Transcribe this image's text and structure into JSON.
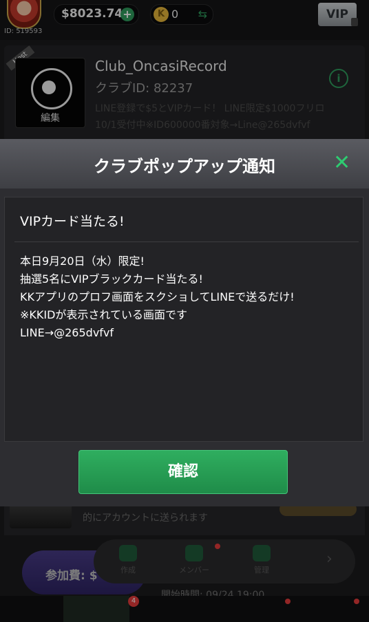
{
  "header": {
    "player_id": "ID: 519593",
    "balance": "$8023.74",
    "coins": "0",
    "vip_label": "VIP"
  },
  "club": {
    "host_tag": "Host",
    "edit_label": "編集",
    "name": "Club_OncasiRecord",
    "club_id": "クラブID: 82237",
    "description_line1": "LINE登録で$5とVIPカード！ LINE限定$1000フリロ",
    "description_line2": "10/1受付中※ID600000番対象→Line@265dvfvf"
  },
  "background": {
    "item_text": "的にアカウントに送られます",
    "join_label": "参加費: $",
    "actions": [
      "作成",
      "メンバー",
      "管理"
    ],
    "start_time": "開始時間: 09/24 19:00",
    "tab_badge": "4"
  },
  "modal": {
    "title": "クラブポップアップ通知",
    "message_title": "VIPカード当たる!",
    "message_lines": [
      "本日9月20日（水）限定!",
      "抽選5名にVIPブラックカード当たる!",
      "KKアプリのプロフ画面をスクショしてLINEで送るだけ!",
      "※KKIDが表示されている画面です",
      "LINE→@265dvfvf"
    ],
    "confirm_label": "確認"
  },
  "colors": {
    "accent_green": "#2ecc71",
    "button_green": "#2fae5f"
  },
  "icons": [
    "plus-icon",
    "coin-icon",
    "swap-icon",
    "info-icon",
    "close-icon",
    "lock-icon"
  ]
}
